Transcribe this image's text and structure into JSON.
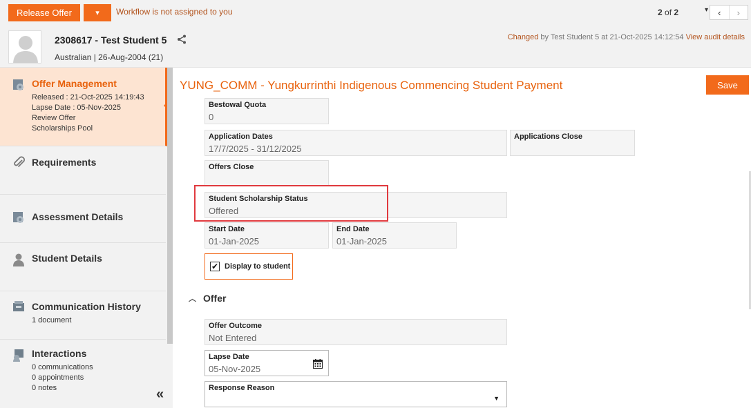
{
  "topbar": {
    "release_offer_label": "Release Offer",
    "dropdown_glyph": "▾",
    "workflow_message": "Workflow is not assigned to you",
    "pager_current": "2",
    "pager_of": "of",
    "pager_total": "2",
    "pager_dropdown_glyph": "▾",
    "prev_glyph": "‹",
    "next_glyph": "›"
  },
  "header": {
    "student_name": "2308617 - Test Student 5",
    "student_meta": "Australian | 26-Aug-2004 (21)",
    "audit_changed": "Changed",
    "audit_by": "by Test Student 5 at 21-Oct-2025 14:12:54",
    "audit_link": "View audit details"
  },
  "sidebar": {
    "items": [
      {
        "title": "Offer Management",
        "subs": [
          "Released : 21-Oct-2025 14:19:43",
          "Lapse Date : 05-Nov-2025",
          "Review Offer",
          "Scholarships Pool"
        ],
        "icon": "gear-doc-icon"
      },
      {
        "title": "Requirements",
        "subs": [],
        "icon": "paperclip-icon"
      },
      {
        "title": "Assessment Details",
        "subs": [],
        "icon": "gear-doc-icon"
      },
      {
        "title": "Student Details",
        "subs": [],
        "icon": "person-icon"
      },
      {
        "title": "Communication History",
        "subs": [
          "1 document"
        ],
        "icon": "inbox-icon"
      },
      {
        "title": "Interactions",
        "subs": [
          "0 communications",
          "0 appointments",
          "0 notes"
        ],
        "icon": "interactions-icon"
      }
    ],
    "collapse_glyph": "«"
  },
  "main": {
    "title": "YUNG_COMM - Yungkurrinthi Indigenous Commencing Student Payment",
    "save_label": "Save",
    "fields": {
      "bestowal_quota": {
        "label": "Bestowal Quota",
        "value": "0"
      },
      "application_dates": {
        "label": "Application Dates",
        "value": "17/7/2025 - 31/12/2025"
      },
      "applications_close": {
        "label": "Applications Close",
        "value": ""
      },
      "offers_close": {
        "label": "Offers Close",
        "value": ""
      },
      "scholarship_status": {
        "label": "Student Scholarship Status",
        "value": "Offered"
      },
      "start_date": {
        "label": "Start Date",
        "value": "01-Jan-2025"
      },
      "end_date": {
        "label": "End Date",
        "value": "01-Jan-2025"
      },
      "offer_outcome": {
        "label": "Offer Outcome",
        "value": "Not Entered"
      },
      "lapse_date": {
        "label": "Lapse Date",
        "value": "05-Nov-2025"
      },
      "response_reason": {
        "label": "Response Reason",
        "value": ""
      }
    },
    "display_to_student": {
      "label": "Display to student",
      "checked_glyph": "✔"
    },
    "offer_section": {
      "label": "Offer",
      "chevron_glyph": "︿"
    }
  },
  "colors": {
    "accent": "#f26a1b",
    "highlight": "#e0393e"
  }
}
